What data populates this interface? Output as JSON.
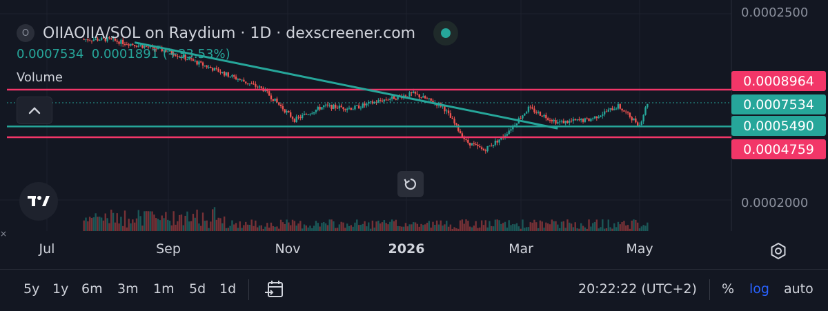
{
  "header": {
    "coin_icon_letter": "O",
    "title": "OIIAOIIA/SOL on Raydium · 1D · dexscreener.com",
    "last_value": "0.0007534",
    "change_value": "0.0001891",
    "change_percent": "(+33.53%)",
    "volume_label": "Volume"
  },
  "price_tags": {
    "upper_resistance": "0.0008964",
    "last_price": "0.0007534",
    "mid_line": "0.0005490",
    "lower_support": "0.0004759"
  },
  "y_axis_labels": [
    "0.0002500",
    "0.0002000"
  ],
  "x_axis_labels": [
    {
      "text": "Jul",
      "bold": false
    },
    {
      "text": "Sep",
      "bold": false
    },
    {
      "text": "Nov",
      "bold": false
    },
    {
      "text": "2026",
      "bold": true
    },
    {
      "text": "Mar",
      "bold": false
    },
    {
      "text": "May",
      "bold": false
    }
  ],
  "toolbar": {
    "timeframes": [
      "5y",
      "1y",
      "6m",
      "3m",
      "1m",
      "5d",
      "1d"
    ],
    "clock": "20:22:22 (UTC+2)",
    "percent_label": "%",
    "log_label": "log",
    "auto_label": "auto"
  },
  "colors": {
    "background": "#131722",
    "up": "#26a69a",
    "down": "#ef5350",
    "resistance": "#f23668",
    "support_line": "#26a69a",
    "log_active": "#2962ff"
  },
  "icons": {
    "collapse": "chevron-up-icon",
    "reset": "reset-icon",
    "logo": "tradingview-logo-icon",
    "settings": "gear-icon",
    "date_range": "calendar-icon"
  },
  "chart_data": {
    "type": "candlestick",
    "pair": "OIIAOIIA/SOL",
    "interval": "1D",
    "y_scale": "log",
    "horizontal_levels": [
      0.0008964,
      0.000549,
      0.0004759
    ],
    "last_price": 0.0007534,
    "trendline": {
      "from": {
        "date": "2025-08-15",
        "price": 0.00168
      },
      "to": {
        "date": "2026-03-20",
        "price": 0.000535
      }
    },
    "x_ticks": [
      "Jul",
      "Sep",
      "Nov",
      "2026",
      "Mar",
      "May"
    ],
    "y_ticks": [
      0.00025,
      0.0002
    ],
    "close_series": {
      "dates": [
        "2025-08-01",
        "2025-09-01",
        "2025-10-01",
        "2025-10-20",
        "2025-11-05",
        "2025-11-20",
        "2025-12-05",
        "2025-12-20",
        "2026-01-05",
        "2026-01-20",
        "2026-02-01",
        "2026-02-10",
        "2026-02-20",
        "2026-03-05",
        "2026-03-20",
        "2026-04-05",
        "2026-04-20",
        "2026-05-01",
        "2026-05-05"
      ],
      "values": [
        0.00175,
        0.0015,
        0.0011,
        0.0009,
        0.0006,
        0.00072,
        0.0007,
        0.00078,
        0.00085,
        0.00072,
        0.00045,
        0.0004,
        0.00048,
        0.0007,
        0.00058,
        0.0006,
        0.00072,
        0.00056,
        0.0007534
      ]
    }
  }
}
